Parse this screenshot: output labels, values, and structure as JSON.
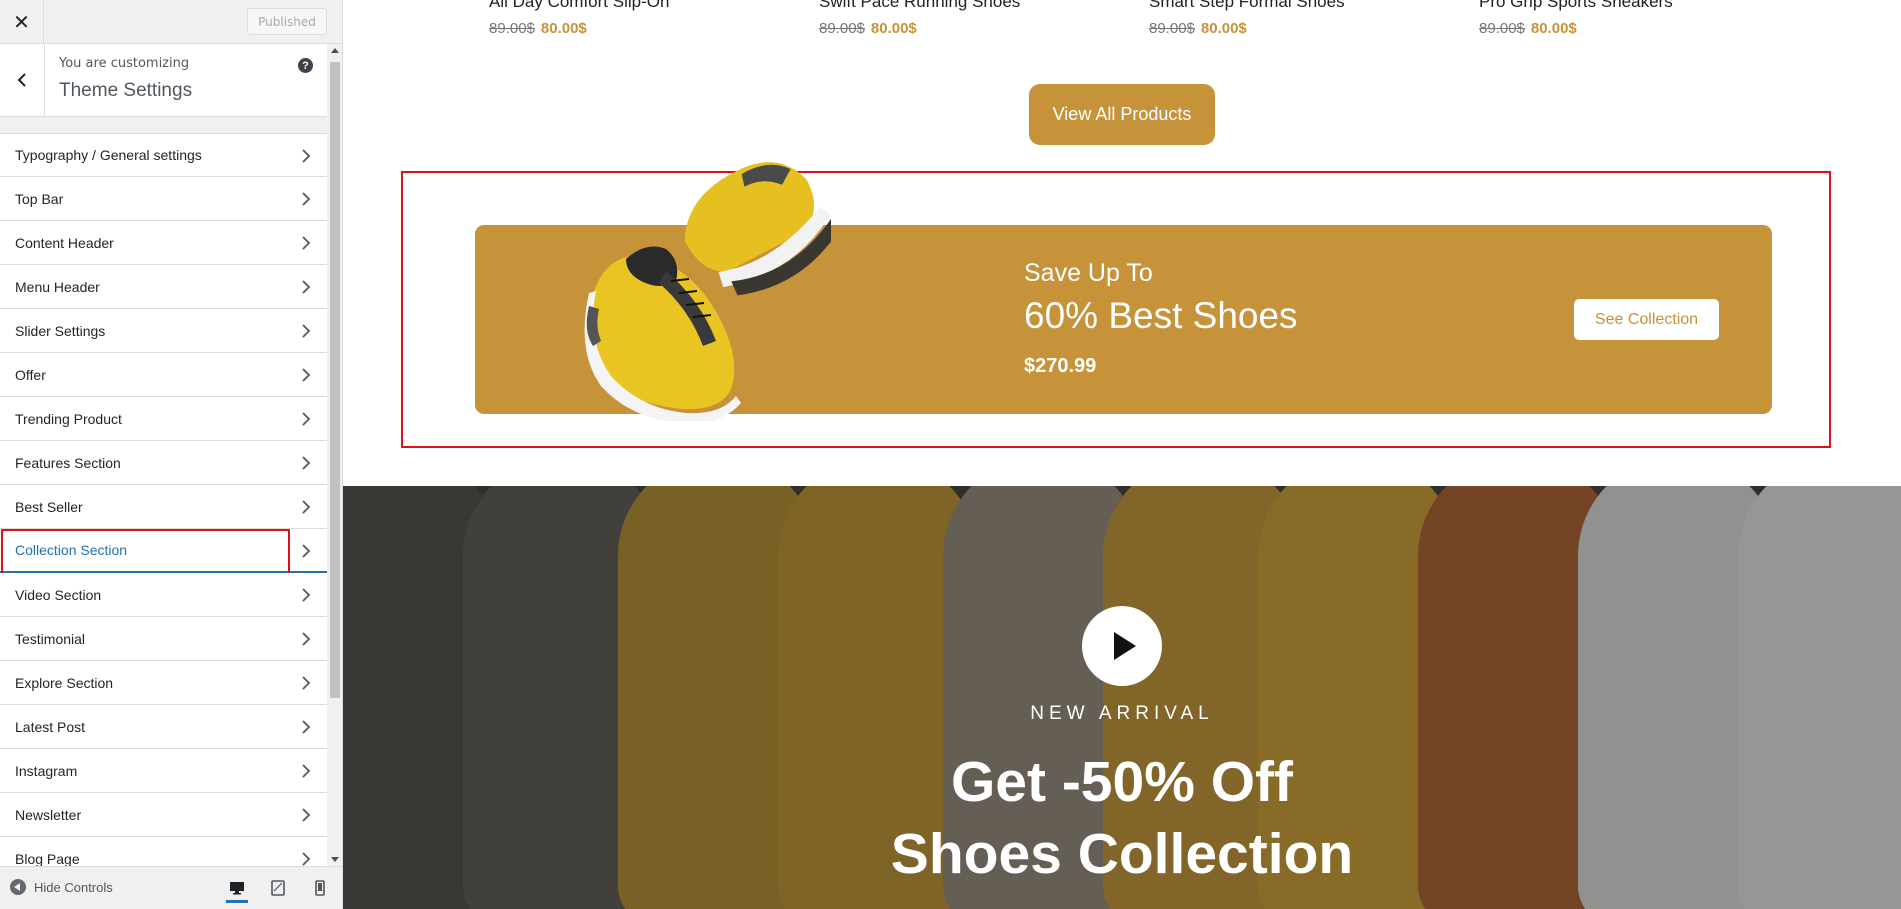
{
  "customizer": {
    "close_icon": "close-icon",
    "published_label": "Published",
    "customizing_label": "You are customizing",
    "section_title": "Theme Settings",
    "help_label": "?",
    "menu": [
      {
        "label": "Typography / General settings"
      },
      {
        "label": "Top Bar"
      },
      {
        "label": "Content Header"
      },
      {
        "label": "Menu Header"
      },
      {
        "label": "Slider Settings"
      },
      {
        "label": "Offer"
      },
      {
        "label": "Trending Product"
      },
      {
        "label": "Features Section"
      },
      {
        "label": "Best Seller"
      },
      {
        "label": "Collection Section",
        "active": true
      },
      {
        "label": "Video Section"
      },
      {
        "label": "Testimonial"
      },
      {
        "label": "Explore Section"
      },
      {
        "label": "Latest Post"
      },
      {
        "label": "Instagram"
      },
      {
        "label": "Newsletter"
      },
      {
        "label": "Blog Page"
      }
    ],
    "hide_controls_label": "Hide Controls",
    "devices": [
      "desktop-icon",
      "tablet-icon",
      "mobile-icon"
    ],
    "active_device": "desktop"
  },
  "preview": {
    "products": [
      {
        "name": "All Day Comfort Slip-On",
        "old_price": "89.00$",
        "new_price": "80.00$"
      },
      {
        "name": "Swift Pace Running Shoes",
        "old_price": "89.00$",
        "new_price": "80.00$"
      },
      {
        "name": "Smart Step Formal Shoes",
        "old_price": "89.00$",
        "new_price": "80.00$"
      },
      {
        "name": "Pro Grip Sports Sneakers",
        "old_price": "89.00$",
        "new_price": "80.00$"
      }
    ],
    "view_all_label": "View All Products",
    "collection": {
      "save_up": "Save Up To",
      "headline": "60% Best Shoes",
      "price": "$270.99",
      "button_label": "See Collection"
    },
    "video": {
      "new_arrival": "NEW ARRIVAL",
      "line1": "Get -50% Off",
      "line2": "Shoes Collection"
    }
  },
  "colors": {
    "accent": "#c6923a",
    "highlight": "#e0101a",
    "wp_blue": "#2271b1"
  }
}
